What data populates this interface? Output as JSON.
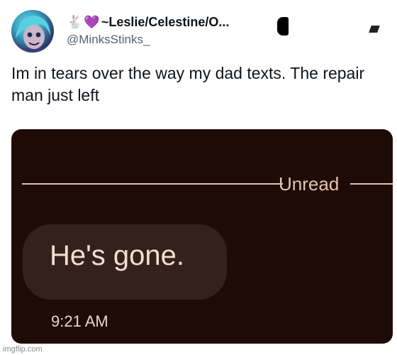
{
  "tweet": {
    "emoji_rabbit": "🐇",
    "emoji_heart": "💜",
    "display_name": "~Leslie/Celestine/O...",
    "handle": "@MinksStinks_",
    "text": "Im in tears over the way my dad texts. The repair man just left"
  },
  "screenshot": {
    "unread_label": "Unread",
    "message_text": "He's gone.",
    "time": "9:21 AM"
  },
  "watermark": "imgflip.com",
  "colors": {
    "message_bg": "#1e0b05",
    "bubble_bg": "#33211c",
    "accent_text": "#e3c3b1"
  }
}
